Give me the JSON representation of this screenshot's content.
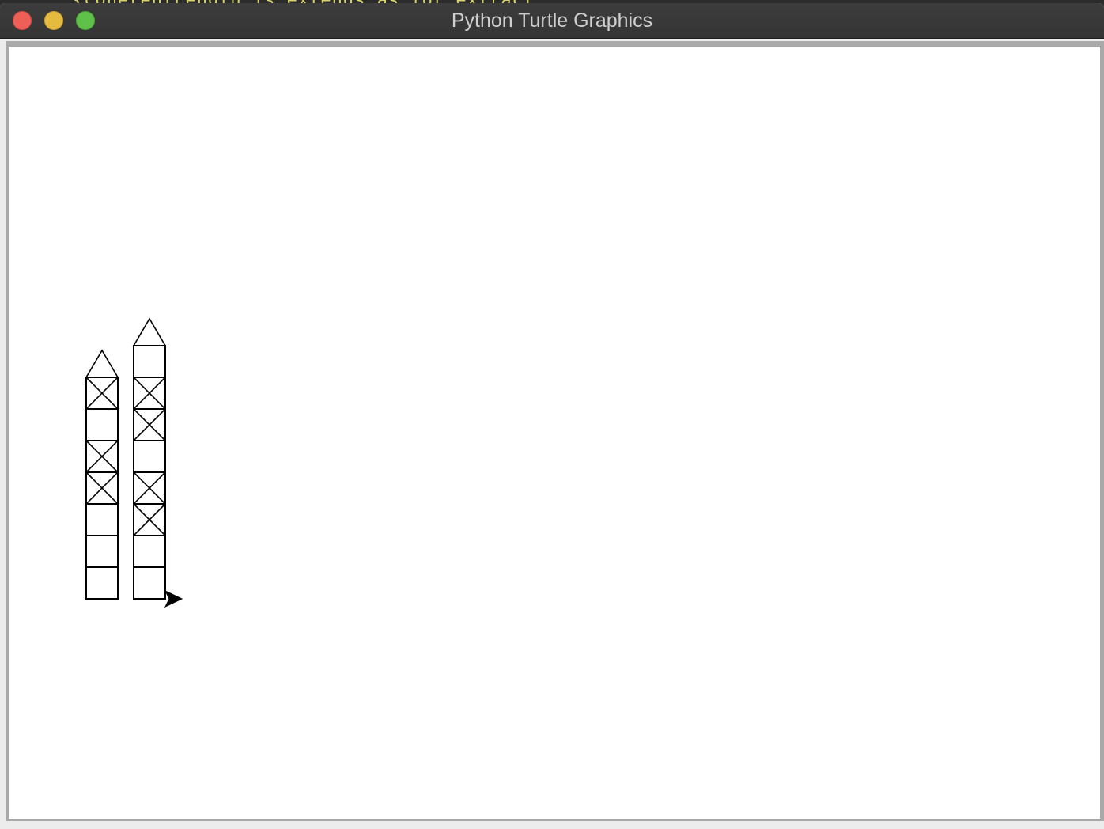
{
  "background": {
    "partial_code": "{coherentLength_is_extends_as_for_extract"
  },
  "window": {
    "title": "Python Turtle Graphics"
  },
  "colors": {
    "canvas": "#ffffff",
    "stroke": "#000000",
    "close": "#ed5f57",
    "minimize": "#e5bb3f",
    "maximize": "#5fc04a"
  },
  "drawing": {
    "towers": [
      {
        "cells_bottom_to_top": [
          "empty",
          "empty",
          "empty",
          "cross",
          "cross",
          "empty",
          "cross"
        ]
      },
      {
        "cells_bottom_to_top": [
          "empty",
          "empty",
          "cross",
          "cross",
          "empty",
          "cross",
          "cross",
          "empty"
        ]
      }
    ],
    "turtle_heading": "right"
  }
}
